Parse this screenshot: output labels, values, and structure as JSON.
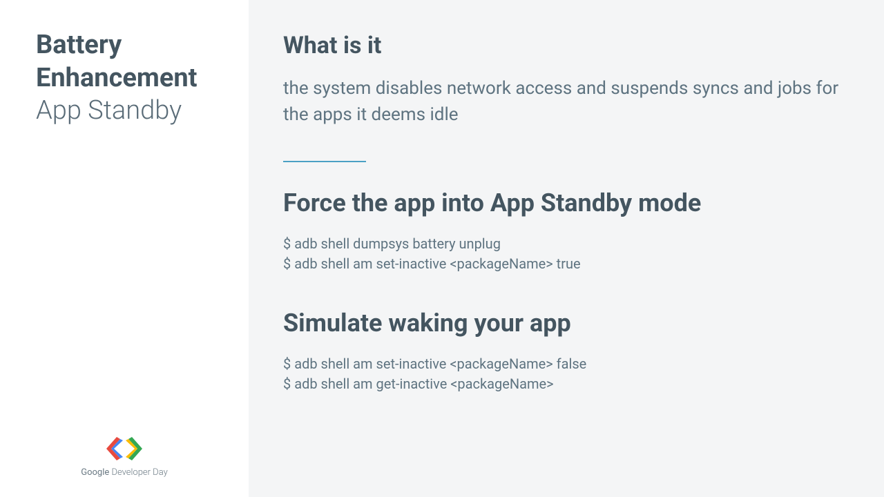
{
  "left": {
    "title_line1": "Battery",
    "title_line2": "Enhancement",
    "subtitle": "App Standby",
    "logo_text_bold": "Google",
    "logo_text_light": " Developer Day"
  },
  "right": {
    "section1": {
      "heading": "What is it",
      "body": "the system disables network access and suspends syncs and jobs for the apps it deems idle"
    },
    "section2": {
      "heading": "Force the app into App Standby mode",
      "code1": "$ adb shell dumpsys battery unplug",
      "code2": "$ adb shell am set-inactive <packageName> true"
    },
    "section3": {
      "heading": "Simulate waking your app",
      "code1": "$ adb shell am set-inactive <packageName> false",
      "code2": "$ adb shell am get-inactive <packageName>"
    }
  }
}
